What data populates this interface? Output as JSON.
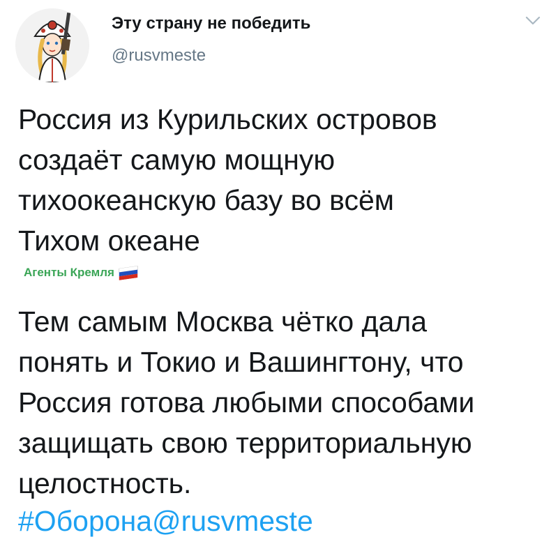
{
  "tweet": {
    "author": {
      "display_name": "Эту страну не победить",
      "handle": "@rusvmeste",
      "avatar_icon": "cossack-girl-avatar-icon"
    },
    "menu_icon": "chevron-down-icon",
    "text_part1": "Россия из Курильских островов\nсоздаёт самую мощную\nтихоокеанскую базу во всём\nТихом океане",
    "watermark": {
      "text": "Агенты Кремля",
      "icon": "russian-flag-icon"
    },
    "text_part2": "Тем самым Москва чётко дала\nпонять и Токио и Вашингтону, что\nРоссия готова любыми способами\nзащищать свою территориальную\nцелостность.",
    "hashtag": "#Оборона@rusvmeste"
  },
  "colors": {
    "text": "#14171a",
    "secondary": "#657786",
    "link": "#1da1f2",
    "watermark": "#3aa556"
  }
}
